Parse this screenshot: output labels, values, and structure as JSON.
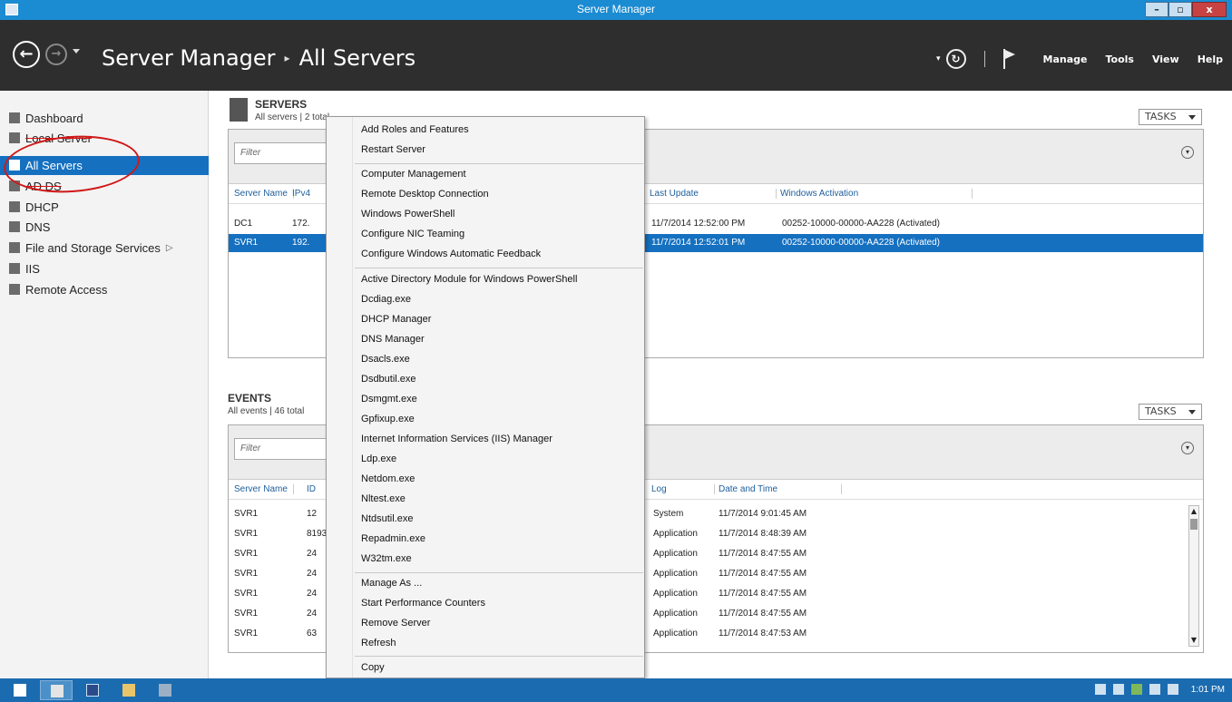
{
  "window": {
    "title": "Server Manager",
    "minimize": "–",
    "maximize": "▫",
    "close": "x"
  },
  "header": {
    "back": "←",
    "forward": "→",
    "breadcrumb": {
      "root": "Server Manager",
      "separator": "▸",
      "current": "All Servers"
    },
    "refresh": "↻",
    "menus": [
      "Manage",
      "Tools",
      "View",
      "Help"
    ]
  },
  "sidebar": {
    "items": [
      {
        "label": "Dashboard",
        "icon": "dashboard-icon"
      },
      {
        "label": "Local Server",
        "icon": "local-server-icon"
      },
      {
        "label": "All Servers",
        "icon": "all-servers-icon",
        "active": true
      },
      {
        "label": "AD DS",
        "icon": "ad-ds-icon"
      },
      {
        "label": "DHCP",
        "icon": "dhcp-icon"
      },
      {
        "label": "DNS",
        "icon": "dns-icon"
      },
      {
        "label": "File and Storage Services",
        "icon": "file-storage-icon",
        "arrow": "▷"
      },
      {
        "label": "IIS",
        "icon": "iis-icon"
      },
      {
        "label": "Remote Access",
        "icon": "remote-access-icon"
      }
    ]
  },
  "servers": {
    "title": "SERVERS",
    "subtitle": "All servers | 2 total",
    "tasks": "TASKS",
    "filter_placeholder": "Filter",
    "columns": [
      "Server Name",
      "IPv4",
      "Last Update",
      "Windows Activation"
    ],
    "rows": [
      {
        "name": "DC1",
        "ip": "172.",
        "last_update": "11/7/2014 12:52:00 PM",
        "activation": "00252-10000-00000-AA228 (Activated)"
      },
      {
        "name": "SVR1",
        "ip": "192.",
        "last_update": "11/7/2014 12:52:01 PM",
        "activation": "00252-10000-00000-AA228 (Activated)",
        "selected": true
      }
    ]
  },
  "events": {
    "title": "EVENTS",
    "subtitle": "All events | 46 total",
    "tasks": "TASKS",
    "filter_placeholder": "Filter",
    "columns": [
      "Server Name",
      "ID",
      "Log",
      "Date and Time"
    ],
    "rows": [
      {
        "server": "SVR1",
        "id": "12",
        "log": "System",
        "datetime": "11/7/2014 9:01:45 AM"
      },
      {
        "server": "SVR1",
        "id": "8193",
        "log": "Application",
        "datetime": "11/7/2014 8:48:39 AM"
      },
      {
        "server": "SVR1",
        "id": "24",
        "log": "Application",
        "datetime": "11/7/2014 8:47:55 AM"
      },
      {
        "server": "SVR1",
        "id": "24",
        "log": "Application",
        "datetime": "11/7/2014 8:47:55 AM"
      },
      {
        "server": "SVR1",
        "id": "24",
        "log": "Application",
        "datetime": "11/7/2014 8:47:55 AM"
      },
      {
        "server": "SVR1",
        "id": "24",
        "log": "Application",
        "datetime": "11/7/2014 8:47:55 AM"
      },
      {
        "server": "SVR1",
        "id": "63",
        "log": "Application",
        "datetime": "11/7/2014 8:47:53 AM"
      }
    ]
  },
  "context_menu": {
    "groups": [
      [
        "Add Roles and Features",
        "Restart Server"
      ],
      [
        "Computer Management",
        "Remote Desktop Connection",
        "Windows PowerShell",
        "Configure NIC Teaming",
        "Configure Windows Automatic Feedback"
      ],
      [
        "Active Directory Module for Windows PowerShell",
        "Dcdiag.exe",
        "DHCP Manager",
        "DNS Manager",
        "Dsacls.exe",
        "Dsdbutil.exe",
        "Dsmgmt.exe",
        "Gpfixup.exe",
        "Internet Information Services (IIS) Manager",
        "Ldp.exe",
        "Netdom.exe",
        "Nltest.exe",
        "Ntdsutil.exe",
        "Repadmin.exe",
        "W32tm.exe"
      ],
      [
        "Manage As ...",
        "Start Performance Counters",
        "Remove Server",
        "Refresh"
      ],
      [
        "Copy"
      ]
    ]
  },
  "taskbar": {
    "buttons": [
      "start-icon",
      "server-manager-icon",
      "powershell-icon",
      "file-explorer-icon",
      "tools-icon"
    ],
    "clock": "1:01 PM"
  },
  "colors": {
    "accent": "#1570c0",
    "titlebar": "#1b8bd2",
    "header": "#2e2e2e",
    "annotation": "#d01818"
  }
}
